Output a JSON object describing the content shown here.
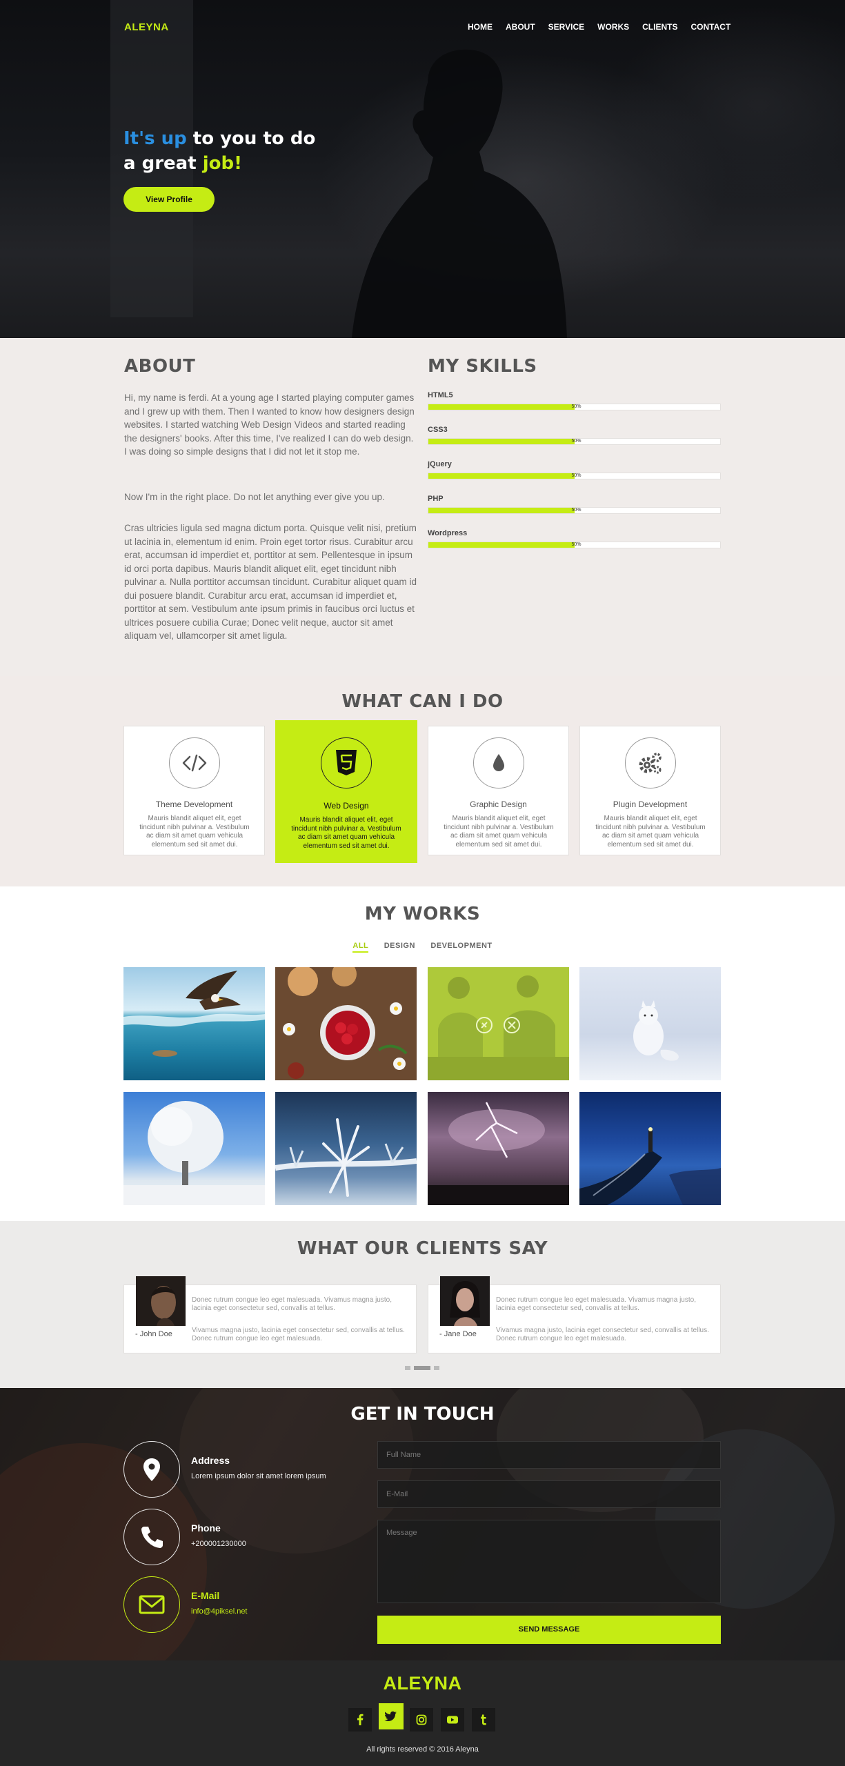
{
  "brand": {
    "logo": "ALEYNA",
    "accent": "#c5ec14",
    "blue": "#2a8fe0"
  },
  "nav": {
    "items": [
      "HOME",
      "ABOUT",
      "SERVICE",
      "WORKS",
      "CLIENTS",
      "CONTACT"
    ]
  },
  "hero": {
    "line1_blue": "It's up",
    "line1_rest": " to you to do",
    "line2_rest": "a great ",
    "line2_lime": "job!",
    "button": "View Profile"
  },
  "about": {
    "title": "ABOUT",
    "p1": "Hi, my name is ferdi. At a young age I started playing computer games and I grew up with them. Then I wanted to know how designers design websites. I started watching Web Design Videos and started reading the designers' books. After this time, I've realized I can do web design. I was doing so simple designs that I did not let it stop me.",
    "p2": "Now I'm in the right place. Do not let anything ever give you up.",
    "p3": "Cras ultricies ligula sed magna dictum porta. Quisque velit nisi, pretium ut lacinia in, elementum id enim. Proin eget tortor risus. Curabitur arcu erat, accumsan id imperdiet et, porttitor at sem. Pellentesque in ipsum id orci porta dapibus. Mauris blandit aliquet elit, eget tincidunt nibh pulvinar a. Nulla porttitor accumsan tincidunt. Curabitur aliquet quam id dui posuere blandit. Curabitur arcu erat, accumsan id imperdiet et, porttitor at sem. Vestibulum ante ipsum primis in faucibus orci luctus et ultrices posuere cubilia Curae; Donec velit neque, auctor sit amet aliquam vel, ullamcorper sit amet ligula."
  },
  "skills": {
    "title": "MY SKILLS",
    "items": [
      {
        "name": "HTML5",
        "pct_label": "50%",
        "value": 0.5
      },
      {
        "name": "CSS3",
        "pct_label": "50%",
        "value": 0.5
      },
      {
        "name": "jQuery",
        "pct_label": "50%",
        "value": 0.5
      },
      {
        "name": "PHP",
        "pct_label": "50%",
        "value": 0.5
      },
      {
        "name": "Wordpress",
        "pct_label": "50%",
        "value": 0.5
      }
    ]
  },
  "services": {
    "title": "WHAT CAN I DO",
    "items": [
      {
        "title": "Theme Development",
        "icon": "code-icon",
        "desc": "Mauris blandit aliquet elit, eget tincidunt nibh pulvinar a. Vestibulum ac diam sit amet quam vehicula elementum sed sit amet dui."
      },
      {
        "title": "Web Design",
        "icon": "html5-icon",
        "desc": "Mauris blandit aliquet elit, eget tincidunt nibh pulvinar a. Vestibulum ac diam sit amet quam vehicula elementum sed sit amet dui."
      },
      {
        "title": "Graphic Design",
        "icon": "droplet-icon",
        "desc": "Mauris blandit aliquet elit, eget tincidunt nibh pulvinar a. Vestibulum ac diam sit amet quam vehicula elementum sed sit amet dui."
      },
      {
        "title": "Plugin Development",
        "icon": "gears-icon",
        "desc": "Mauris blandit aliquet elit, eget tincidunt nibh pulvinar a. Vestibulum ac diam sit amet quam vehicula elementum sed sit amet dui."
      }
    ]
  },
  "works": {
    "title": "MY WORKS",
    "filters": [
      "ALL",
      "DESIGN",
      "DEVELOPMENT"
    ],
    "tiles": [
      "eagle-over-sea-photo",
      "raspberries-table-photo",
      "couple-cooking-photo",
      "arctic-fox-photo",
      "frosted-tree-photo",
      "frost-crystals-photo",
      "lightning-storm-photo",
      "lighthouse-pier-photo"
    ]
  },
  "clients": {
    "title": "WHAT OUR CLIENTS SAY",
    "items": [
      {
        "name": "- John Doe",
        "t1": "Donec rutrum congue leo eget malesuada. Vivamus magna justo, lacinia eget consectetur sed, convallis at tellus.",
        "t2": "Vivamus magna justo, lacinia eget consectetur sed, convallis at tellus. Donec rutrum congue leo eget malesuada."
      },
      {
        "name": "- Jane Doe",
        "t1": "Donec rutrum congue leo eget malesuada. Vivamus magna justo, lacinia eget consectetur sed, convallis at tellus.",
        "t2": "Vivamus magna justo, lacinia eget consectetur sed, convallis at tellus. Donec rutrum congue leo eget malesuada."
      }
    ]
  },
  "contact": {
    "title": "GET IN TOUCH",
    "address_title": "Address",
    "address_text": "Lorem ipsum dolor sit amet lorem ipsum",
    "phone_title": "Phone",
    "phone_text": "+200001230000",
    "email_title": "E-Mail",
    "email_text": "info@4piksel.net",
    "name_placeholder": "Full Name",
    "email_placeholder": "E-Mail",
    "message_placeholder": "Message",
    "send": "SEND MESSAGE"
  },
  "footer": {
    "logo": "ALEYNA",
    "copyright": "All rights reserved © 2016 Aleyna",
    "social": [
      "facebook-icon",
      "twitter-icon",
      "instagram-icon",
      "youtube-icon",
      "tumblr-icon"
    ]
  }
}
